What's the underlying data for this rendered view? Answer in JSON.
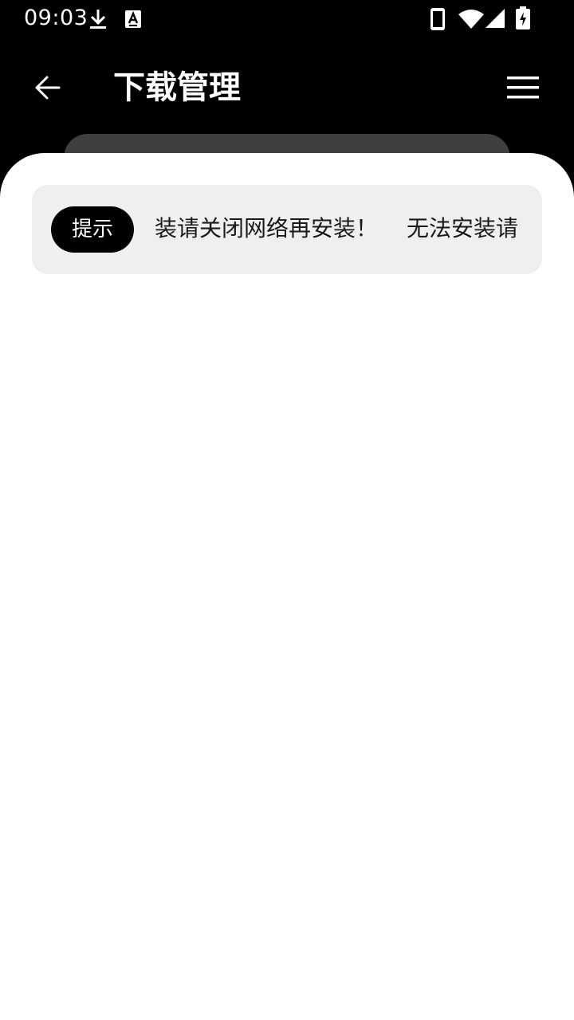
{
  "status_bar": {
    "time": "09:03",
    "left_icons": [
      "download-icon",
      "keyboard-a-icon"
    ],
    "right_icons": [
      "phone-icon",
      "wifi-icon",
      "signal-icon",
      "battery-charging-icon"
    ]
  },
  "app_bar": {
    "back_icon": "arrow-left-icon",
    "title": "下载管理",
    "menu_icon": "hamburger-menu-icon"
  },
  "notice": {
    "badge_label": "提示",
    "marquee_visible_start": "装请关闭网络再安装！",
    "marquee_visible_next": "无法安装请"
  },
  "colors": {
    "background": "#000000",
    "sheet": "#ffffff",
    "notice_bg": "#efefef",
    "back_card": "#3f3f3f",
    "badge_bg": "#000000"
  }
}
